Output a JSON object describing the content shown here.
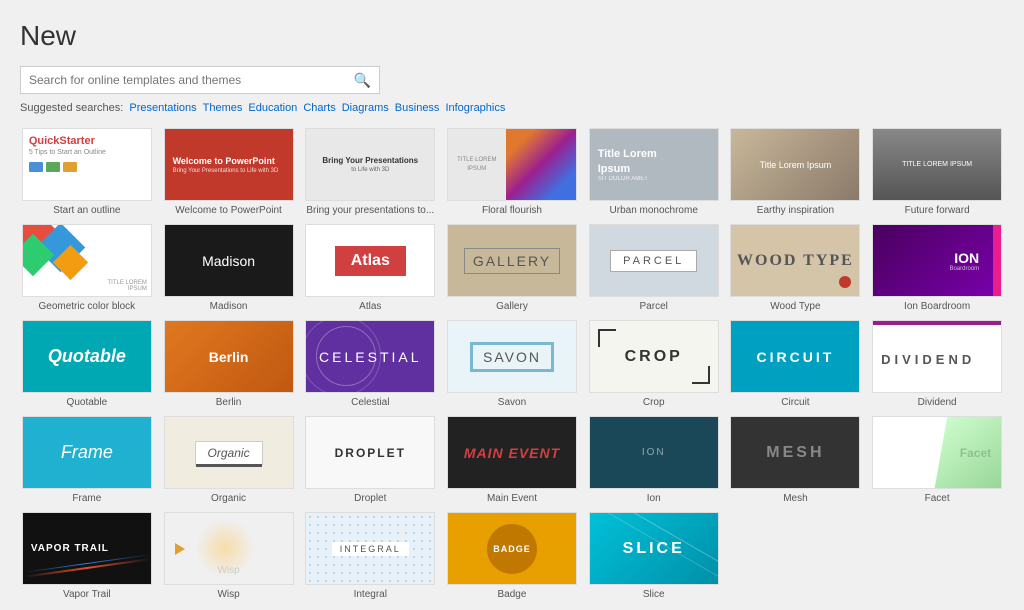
{
  "page": {
    "title": "New"
  },
  "search": {
    "placeholder": "Search for online templates and themes",
    "button_icon": "🔍"
  },
  "suggested": {
    "label": "Suggested searches:",
    "links": [
      "Presentations",
      "Themes",
      "Education",
      "Charts",
      "Diagrams",
      "Business",
      "Infographics"
    ]
  },
  "templates": [
    {
      "id": "quickstarter",
      "label": "Start an outline"
    },
    {
      "id": "welcome",
      "label": "Welcome to PowerPoint"
    },
    {
      "id": "bring",
      "label": "Bring your presentations to..."
    },
    {
      "id": "floral",
      "label": "Floral flourish"
    },
    {
      "id": "urban",
      "label": "Urban monochrome"
    },
    {
      "id": "earthy",
      "label": "Earthy inspiration"
    },
    {
      "id": "future",
      "label": "Future forward"
    },
    {
      "id": "geometric",
      "label": "Geometric color block"
    },
    {
      "id": "madison",
      "label": "Madison"
    },
    {
      "id": "atlas",
      "label": "Atlas"
    },
    {
      "id": "gallery",
      "label": "Gallery"
    },
    {
      "id": "parcel",
      "label": "Parcel"
    },
    {
      "id": "woodtype",
      "label": "Wood Type"
    },
    {
      "id": "ion-boardroom",
      "label": "Ion Boardroom"
    },
    {
      "id": "quotable",
      "label": "Quotable"
    },
    {
      "id": "berlin",
      "label": "Berlin"
    },
    {
      "id": "celestial",
      "label": "Celestial"
    },
    {
      "id": "savon",
      "label": "Savon"
    },
    {
      "id": "crop",
      "label": "Crop"
    },
    {
      "id": "circuit",
      "label": "Circuit"
    },
    {
      "id": "dividend",
      "label": "Dividend"
    },
    {
      "id": "frame",
      "label": "Frame"
    },
    {
      "id": "organic",
      "label": "Organic"
    },
    {
      "id": "droplet",
      "label": "Droplet"
    },
    {
      "id": "mainevent",
      "label": "Main Event"
    },
    {
      "id": "ion",
      "label": "Ion"
    },
    {
      "id": "mesh",
      "label": "Mesh"
    },
    {
      "id": "facet",
      "label": "Facet"
    },
    {
      "id": "vaportrail",
      "label": "Vapor Trail"
    },
    {
      "id": "wisp",
      "label": "Wisp"
    },
    {
      "id": "integral",
      "label": "Integral"
    },
    {
      "id": "badge",
      "label": "Badge"
    },
    {
      "id": "slice",
      "label": "Slice"
    }
  ],
  "template_texts": {
    "quickstarter": "QuickStarter",
    "welcome_title": "Welcome to PowerPoint",
    "welcome_sub": "Bring Your Presentations to Life with 3D",
    "bring_title": "Bring Your Presentations",
    "bring_sub": "to Life with 3D",
    "floral_text": "TITLE LOREM IPSUM",
    "urban_title": "Title Lorem",
    "urban_sub": "Ipsum",
    "urban_tiny": "SIT DOLOR AMET",
    "earthy_title": "Title Lorem Ipsum",
    "future_title": "TITLE LOREM IPSUM",
    "madison_title": "Madison",
    "atlas_title": "Atlas",
    "gallery_title": "GALLERY",
    "parcel_title": "PARCEL",
    "woodtype_title": "WOOD TYPE",
    "ion_boardroom_title": "ION",
    "quotable_title": "Quotable",
    "berlin_title": "Berlin",
    "celestial_title": "CELESTIAL",
    "savon_title": "SAVON",
    "crop_title": "CROP",
    "circuit_title": "CIRCUIT",
    "dividend_title": "DIVIDEND",
    "frame_title": "Frame",
    "organic_title": "Organic",
    "droplet_title": "DROPLET",
    "mainevent_title": "MAIN EVENT",
    "ion_title": "ION",
    "mesh_title": "MESH",
    "facet_title": "Facet",
    "vaportrail_title": "VAPOR TRAIL",
    "wisp_title": "Wisp",
    "integral_title": "INTEGRAL",
    "badge_title": "BADGE",
    "slice_title": "SLICE"
  }
}
